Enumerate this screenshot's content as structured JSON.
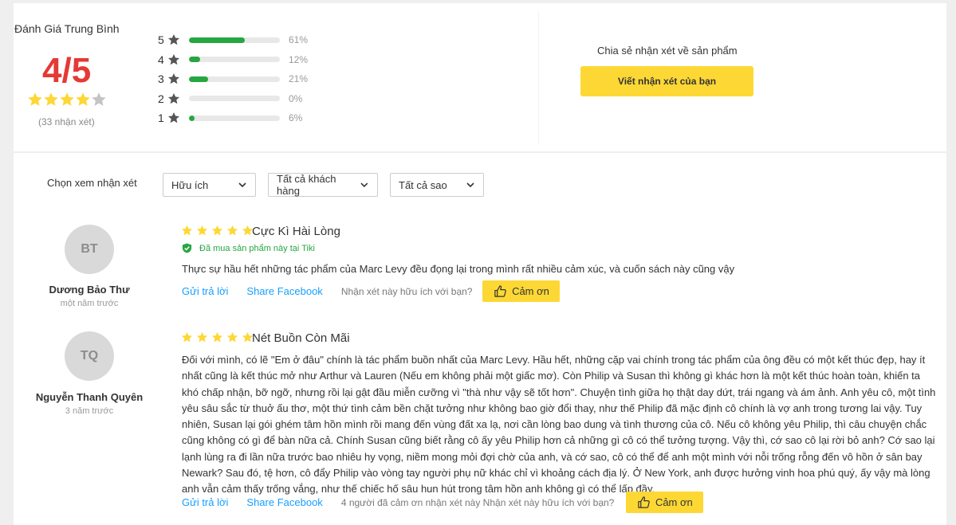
{
  "summary": {
    "title": "Đánh Giá Trung Bình",
    "score": "4/5",
    "rating_out_of_5": 4,
    "count_text": "(33 nhận xét)",
    "bars": [
      {
        "stars": "5",
        "percent": 61,
        "label": "61%"
      },
      {
        "stars": "4",
        "percent": 12,
        "label": "12%"
      },
      {
        "stars": "3",
        "percent": 21,
        "label": "21%"
      },
      {
        "stars": "2",
        "percent": 0,
        "label": "0%"
      },
      {
        "stars": "1",
        "percent": 6,
        "label": "6%"
      }
    ]
  },
  "share": {
    "label": "Chia sẻ nhận xét về sản phẩm",
    "button": "Viết nhận xét của bạn"
  },
  "filters": {
    "label": "Chọn xem nhận xét",
    "sort": "Hữu ích",
    "customers": "Tất cả khách hàng",
    "stars": "Tất cả sao"
  },
  "reviews": [
    {
      "initials": "BT",
      "author": "Dương Bảo Thư",
      "time": "một năm trước",
      "rating": 5,
      "title": "Cực Kì Hài Lòng",
      "verified": "Đã mua sản phẩm này tại Tiki",
      "text": "Thực sự hầu hết những tác phẩm của Marc Levy đều đọng lại trong mình rất nhiều cảm xúc, và cuốn sách này cũng vậy",
      "reply": "Gửi trả lời",
      "share": "Share Facebook",
      "helpful_question": "Nhận xét này hữu ích với bạn?",
      "thanks": "Cảm ơn"
    },
    {
      "initials": "TQ",
      "author": "Nguyễn Thanh Quyên",
      "time": "3 năm trước",
      "rating": 5,
      "title": "Nét Buồn Còn Mãi",
      "text_lines": [
        "Đối với mình, có lẽ \"Em ở đâu\" chính là tác phẩm buồn nhất của Marc Levy. Hầu hết, những cặp vai chính trong tác phẩm của ông đều có một kết thúc đẹp, hay ít",
        "nhất cũng là kết thúc mở như Arthur và Lauren (Nếu em không phải một giấc mơ). Còn Philip và Susan thì không gì khác hơn là một kết thúc hoàn toàn, khiến ta",
        "khó chấp nhận, bỡ ngỡ, nhưng rồi lại gật đầu miễn cưỡng vì \"thà như vậy sẽ tốt hơn\". Chuyện tình giữa họ thật day dứt, trái ngang và ám ảnh. Anh yêu cô, một tình",
        "yêu sâu sắc từ thuở ấu thơ, một thứ tình cảm bền chặt tưởng như không bao giờ đổi thay, như thế Philip đã mặc định cô chính là vợ anh trong tương lai vậy. Tuy",
        "nhiên, Susan lại gói ghém tâm hồn mình rồi mang đến vùng đất xa lạ, nơi cần lòng bao dung và tình thương của cô. Nếu cô không yêu Philip, thì câu chuyện chắc",
        "cũng không có gì để bàn nữa cả. Chính Susan cũng biết rằng cô ấy yêu Philip hơn cả những gì cô có thể tưởng tượng. Vậy thì, cớ sao cô lại rời bỏ anh? Cớ sao lại",
        "lạnh lùng ra đi lần nữa trước bao nhiêu hy vọng, niềm mong mỏi đợi chờ của anh, và cớ sao, cô có thể để anh một mình với nỗi trống rỗng đến vô hồn ở sân bay",
        "Newark? Sau đó, tệ hơn, cô đẩy Philip vào vòng tay người phụ nữ khác chỉ vì khoảng cách địa lý. Ở New York, anh được hưởng vinh hoa phú quý, ấy vậy mà lòng",
        "anh vẫn cảm thấy trống vắng, như thế chiếc hố sâu hun hút trong tâm hồn anh không gì có thể lấp đầy."
      ],
      "reply": "Gửi trả lời",
      "share": "Share Facebook",
      "helpful_question": "4 người đã cảm ơn nhận xét này Nhận xét này hữu ích với bạn?",
      "thanks": "Cảm ơn"
    }
  ],
  "colors": {
    "star": "#fdd835",
    "star_empty": "#c4c4c4",
    "score": "#e53935",
    "bar_fill": "#26a641",
    "accent_button": "#fdd835",
    "link": "#189eff",
    "verified": "#26a641"
  }
}
